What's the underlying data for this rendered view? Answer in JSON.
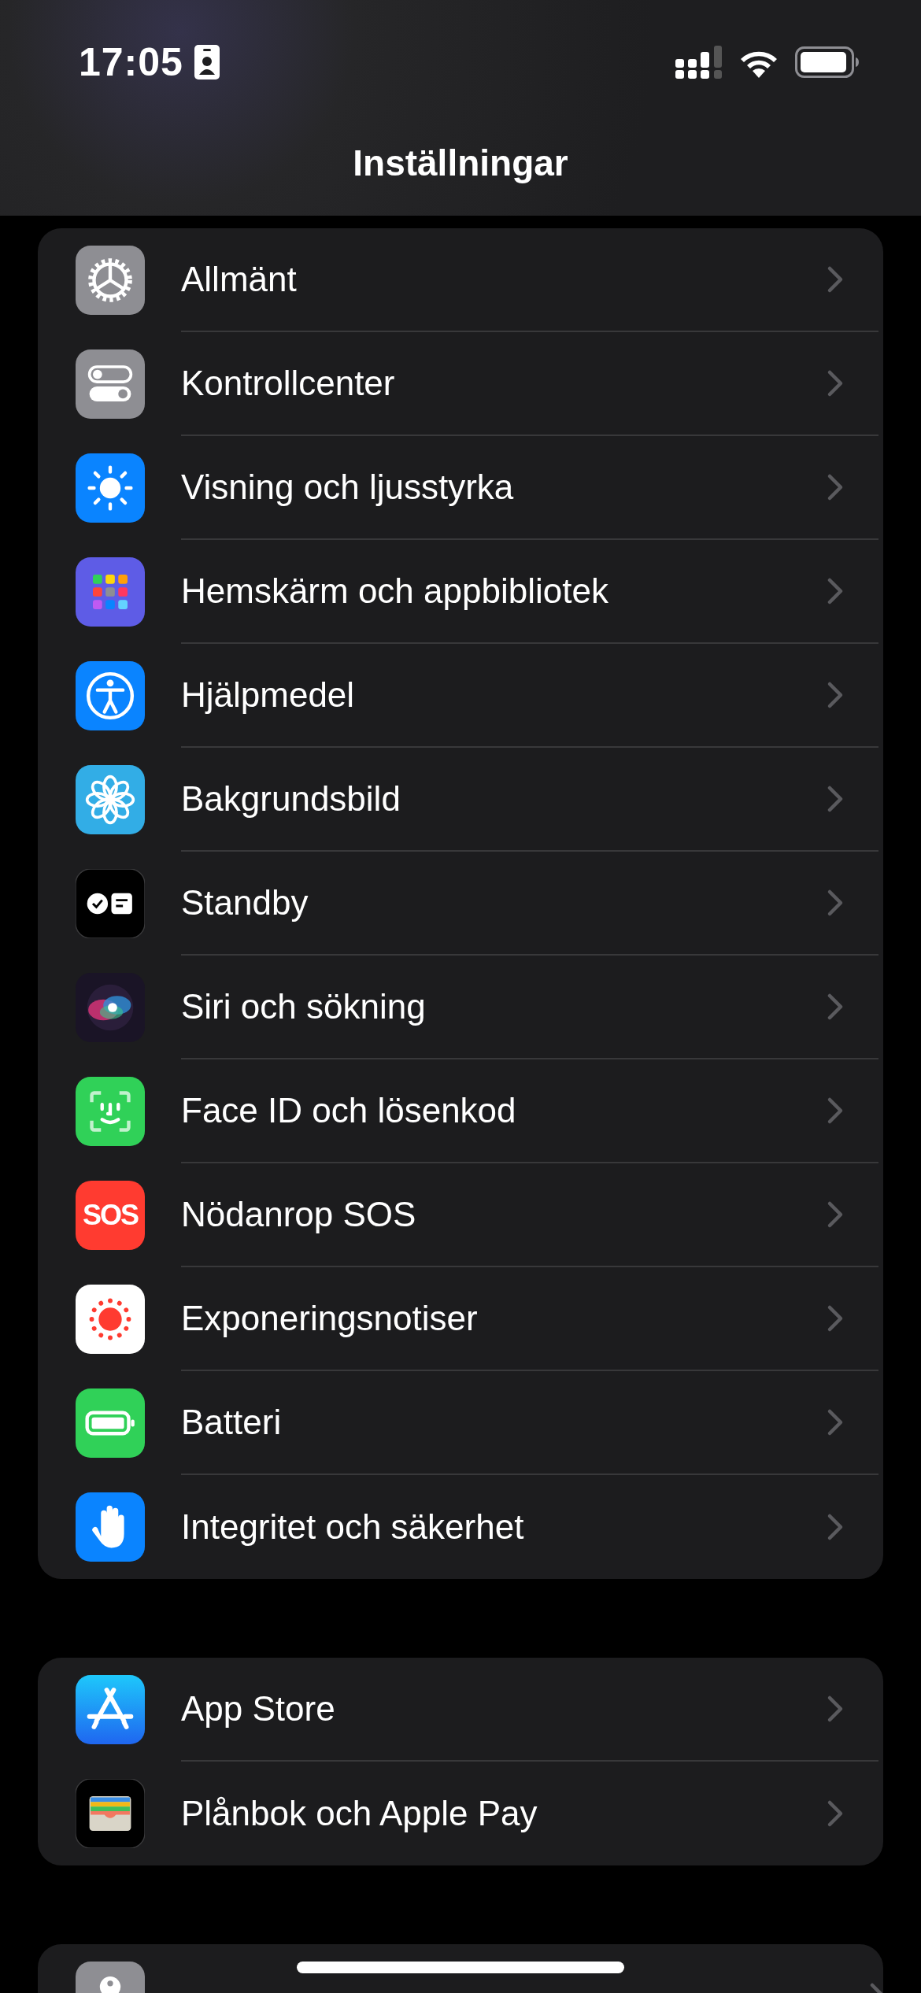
{
  "status_bar": {
    "time": "17:05"
  },
  "nav": {
    "title": "Inställningar"
  },
  "groups": [
    {
      "rows": [
        {
          "label": "Allmänt"
        },
        {
          "label": "Kontrollcenter"
        },
        {
          "label": "Visning och ljusstyrka"
        },
        {
          "label": "Hemskärm och appbibliotek"
        },
        {
          "label": "Hjälpmedel"
        },
        {
          "label": "Bakgrundsbild"
        },
        {
          "label": "Standby"
        },
        {
          "label": "Siri och sökning"
        },
        {
          "label": "Face ID och lösenkod"
        },
        {
          "label": "Nödanrop SOS",
          "badge": "SOS"
        },
        {
          "label": "Exponeringsnotiser"
        },
        {
          "label": "Batteri"
        },
        {
          "label": "Integritet och säkerhet"
        }
      ]
    },
    {
      "rows": [
        {
          "label": "App Store"
        },
        {
          "label": "Plånbok och Apple Pay"
        }
      ]
    }
  ]
}
